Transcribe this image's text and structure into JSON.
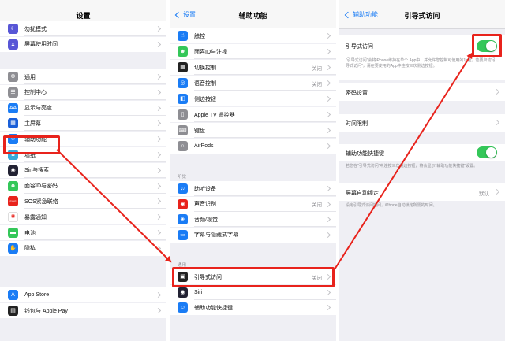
{
  "screens": [
    {
      "title": "设置",
      "groups": [
        {
          "items": [
            {
              "label": "勿扰模式",
              "icon": "moon-icon",
              "icon_color": "#5856d6",
              "glyph": "☾"
            },
            {
              "label": "屏幕使用时间",
              "icon": "hourglass-icon",
              "icon_color": "#5856d6",
              "glyph": "⧗"
            }
          ]
        },
        {
          "items": [
            {
              "label": "通用",
              "icon": "gear-icon",
              "icon_color": "#8e8e93",
              "glyph": "⚙"
            },
            {
              "label": "控制中心",
              "icon": "toggles-icon",
              "icon_color": "#8e8e93",
              "glyph": "☰"
            },
            {
              "label": "显示与亮度",
              "icon": "text-size-icon",
              "icon_color": "#1a7cf5",
              "glyph": "AA"
            },
            {
              "label": "主屏幕",
              "icon": "home-grid-icon",
              "icon_color": "#1a5fd8",
              "glyph": "▦"
            },
            {
              "label": "辅助功能",
              "icon": "accessibility-icon",
              "icon_color": "#1a7cf5",
              "glyph": "☺"
            },
            {
              "label": "墙纸",
              "icon": "flower-icon",
              "icon_color": "#35aadc",
              "glyph": "✿"
            },
            {
              "label": "Siri与搜索",
              "icon": "siri-icon",
              "icon_color": "#222233",
              "glyph": "◉"
            },
            {
              "label": "面容ID与密码",
              "icon": "faceid-icon",
              "icon_color": "#34c759",
              "glyph": "☻"
            },
            {
              "label": "SOS紧急联络",
              "icon": "sos-icon",
              "icon_color": "#e8231c",
              "glyph": "SOS"
            },
            {
              "label": "暴露通知",
              "icon": "virus-icon",
              "icon_color": "#ffffff",
              "glyph": "✺"
            },
            {
              "label": "电池",
              "icon": "battery-icon",
              "icon_color": "#34c759",
              "glyph": "▬"
            },
            {
              "label": "隐私",
              "icon": "hand-icon",
              "icon_color": "#1a7cf5",
              "glyph": "✋"
            }
          ]
        },
        {
          "items": [
            {
              "label": "App Store",
              "icon": "appstore-icon",
              "icon_color": "#1a7cf5",
              "glyph": "A"
            },
            {
              "label": "钱包与 Apple Pay",
              "icon": "wallet-icon",
              "icon_color": "#222222",
              "glyph": "▤"
            }
          ]
        }
      ]
    },
    {
      "title": "辅助功能",
      "back": "设置",
      "groups": [
        {
          "items": [
            {
              "label": "触控",
              "icon": "touch-icon",
              "icon_color": "#1a7cf5",
              "glyph": "☝",
              "value": ""
            },
            {
              "label": "面容ID与注视",
              "icon": "faceid-icon",
              "icon_color": "#34c759",
              "glyph": "☻",
              "value": ""
            },
            {
              "label": "切换控制",
              "icon": "switch-control-icon",
              "icon_color": "#222222",
              "glyph": "▦",
              "value": "关闭"
            },
            {
              "label": "语音控制",
              "icon": "voice-control-icon",
              "icon_color": "#1a7cf5",
              "glyph": "◎",
              "value": "关闭"
            },
            {
              "label": "侧边按钮",
              "icon": "side-button-icon",
              "icon_color": "#1a7cf5",
              "glyph": "◧",
              "value": ""
            },
            {
              "label": "Apple TV 遥控器",
              "icon": "remote-icon",
              "icon_color": "#8e8e93",
              "glyph": "▯",
              "value": ""
            },
            {
              "label": "键盘",
              "icon": "keyboard-icon",
              "icon_color": "#8e8e93",
              "glyph": "⌨",
              "value": ""
            },
            {
              "label": "AirPods",
              "icon": "airpods-icon",
              "icon_color": "#8e8e93",
              "glyph": "∩",
              "value": ""
            }
          ]
        },
        {
          "header": "听觉",
          "items": [
            {
              "label": "助听设备",
              "icon": "ear-icon",
              "icon_color": "#1a7cf5",
              "glyph": "♫",
              "value": ""
            },
            {
              "label": "声音识别",
              "icon": "sound-recognition-icon",
              "icon_color": "#e8231c",
              "glyph": "◉",
              "value": "关闭"
            },
            {
              "label": "音频/视觉",
              "icon": "speaker-icon",
              "icon_color": "#1a7cf5",
              "glyph": "◈",
              "value": ""
            },
            {
              "label": "字幕与隐藏式字幕",
              "icon": "captions-icon",
              "icon_color": "#1a7cf5",
              "glyph": "▭",
              "value": ""
            }
          ]
        },
        {
          "header": "通用",
          "items": [
            {
              "label": "引导式访问",
              "icon": "lock-icon",
              "icon_color": "#222222",
              "glyph": "▣",
              "value": "关闭"
            },
            {
              "label": "Siri",
              "icon": "siri-icon",
              "icon_color": "#222233",
              "glyph": "◉",
              "value": ""
            },
            {
              "label": "辅助功能快捷键",
              "icon": "accessibility-icon",
              "icon_color": "#1a7cf5",
              "glyph": "☺",
              "value": ""
            }
          ]
        }
      ]
    },
    {
      "title": "引导式访问",
      "back": "辅助功能",
      "guided_access": {
        "label": "引导式访问",
        "on": true
      },
      "guided_access_note": "\"引导式访问\"会将iPhone维持在单个 App中，并允许您控制可使用的功能。若要启动\"引导式访问\"，请在要使用的App中连按三次侧边按钮。",
      "passcode_settings": "密码设置",
      "time_limits": "时间限制",
      "shortcut": {
        "label": "辅助功能快捷键",
        "on": true
      },
      "shortcut_note": "若您在\"引导式访问\"中连按三次侧边按钮，将会显示\"辅助功能快捷键\"设置。",
      "auto_lock": {
        "label": "屏幕自动锁定",
        "value": "默认"
      },
      "auto_lock_note": "设定引导式访问期间，iPhone自动锁定所需的时间。"
    }
  ],
  "accent": "#1a7cf5",
  "highlight_color": "#e8231c",
  "toggle_color": "#34c759"
}
